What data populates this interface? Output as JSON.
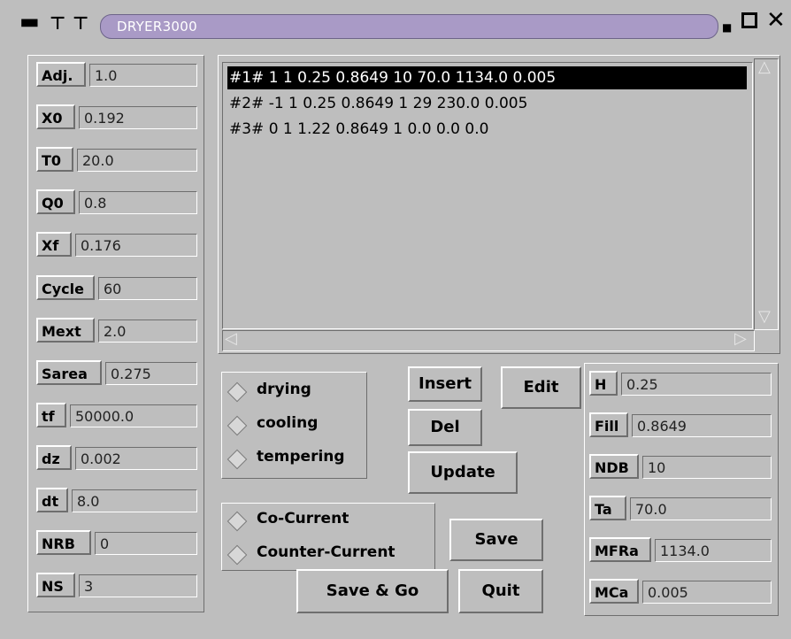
{
  "window": {
    "title": "DRYER3000"
  },
  "params_left": [
    {
      "label": "Adj.",
      "value": "1.0"
    },
    {
      "label": "X0",
      "value": "0.192"
    },
    {
      "label": "T0",
      "value": "20.0"
    },
    {
      "label": "Q0",
      "value": "0.8"
    },
    {
      "label": "Xf",
      "value": "0.176"
    },
    {
      "label": "Cycle",
      "value": "60"
    },
    {
      "label": "Mext",
      "value": "2.0"
    },
    {
      "label": "Sarea",
      "value": "0.275"
    },
    {
      "label": "tf",
      "value": "50000.0"
    },
    {
      "label": "dz",
      "value": "0.002"
    },
    {
      "label": "dt",
      "value": "8.0"
    },
    {
      "label": "NRB",
      "value": "0"
    },
    {
      "label": "NS",
      "value": "3"
    }
  ],
  "list": {
    "items": [
      "#1# 1 1 0.25 0.8649 10 70.0 1134.0 0.005",
      "#2# -1 1 0.25 0.8649 1 29 230.0 0.005",
      "#3# 0 1 1.22 0.8649 1 0.0 0.0 0.0"
    ],
    "selected_index": 0
  },
  "process_mode": {
    "options": [
      "drying",
      "cooling",
      "tempering"
    ]
  },
  "flow_mode": {
    "options": [
      "Co-Current",
      "Counter-Current"
    ]
  },
  "buttons": {
    "insert": "Insert",
    "edit": "Edit",
    "del": "Del",
    "update": "Update",
    "save": "Save",
    "save_go": "Save & Go",
    "quit": "Quit"
  },
  "params_right": [
    {
      "label": "H",
      "value": "0.25"
    },
    {
      "label": "Fill",
      "value": "0.8649"
    },
    {
      "label": "NDB",
      "value": "10"
    },
    {
      "label": "Ta",
      "value": "70.0"
    },
    {
      "label": "MFRa",
      "value": "1134.0"
    },
    {
      "label": "MCa",
      "value": "0.005"
    }
  ]
}
